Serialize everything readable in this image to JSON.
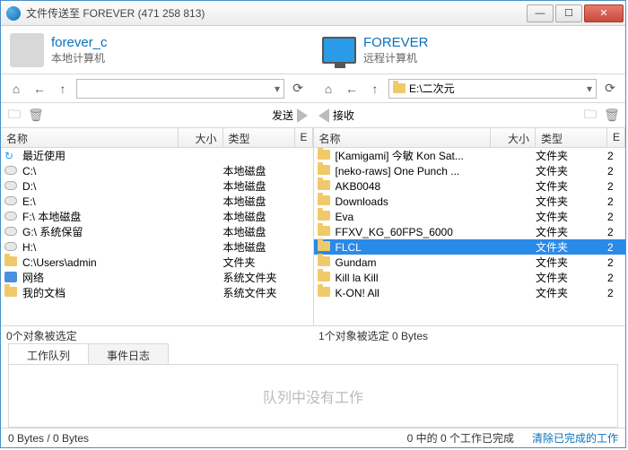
{
  "window": {
    "title": "文件传送至 FOREVER (471 258 813)"
  },
  "hosts": {
    "local": {
      "name": "forever_c",
      "sub": "本地计算机"
    },
    "remote": {
      "name": "FOREVER",
      "sub": "远程计算机"
    }
  },
  "nav": {
    "remote_path": "E:\\二次元"
  },
  "actions": {
    "send": "发送",
    "recv": "接收"
  },
  "columns": {
    "name": "名称",
    "size": "大小",
    "type": "类型",
    "e": "E"
  },
  "local_items": [
    {
      "icon": "recent",
      "name": "最近使用",
      "type": ""
    },
    {
      "icon": "drive",
      "name": "C:\\",
      "type": "本地磁盘"
    },
    {
      "icon": "drive",
      "name": "D:\\",
      "type": "本地磁盘"
    },
    {
      "icon": "drive",
      "name": "E:\\",
      "type": "本地磁盘"
    },
    {
      "icon": "drive",
      "name": "F:\\ 本地磁盘",
      "type": "本地磁盘"
    },
    {
      "icon": "drive",
      "name": "G:\\ 系统保留",
      "type": "本地磁盘"
    },
    {
      "icon": "drive",
      "name": "H:\\",
      "type": "本地磁盘"
    },
    {
      "icon": "folder",
      "name": "C:\\Users\\admin",
      "type": "文件夹"
    },
    {
      "icon": "net",
      "name": "网络",
      "type": "系统文件夹"
    },
    {
      "icon": "folder",
      "name": "我的文档",
      "type": "系统文件夹"
    }
  ],
  "remote_items": [
    {
      "name": "[Kamigami] 今敏 Kon Sat...",
      "type": "文件夹",
      "e": "2"
    },
    {
      "name": "[neko-raws] One Punch ...",
      "type": "文件夹",
      "e": "2"
    },
    {
      "name": "AKB0048",
      "type": "文件夹",
      "e": "2"
    },
    {
      "name": "Downloads",
      "type": "文件夹",
      "e": "2"
    },
    {
      "name": "Eva",
      "type": "文件夹",
      "e": "2"
    },
    {
      "name": "FFXV_KG_60FPS_6000",
      "type": "文件夹",
      "e": "2"
    },
    {
      "name": "FLCL",
      "type": "文件夹",
      "e": "2",
      "selected": true
    },
    {
      "name": "Gundam",
      "type": "文件夹",
      "e": "2"
    },
    {
      "name": "Kill la Kill",
      "type": "文件夹",
      "e": "2"
    },
    {
      "name": "K-ON! All",
      "type": "文件夹",
      "e": "2"
    }
  ],
  "status": {
    "left": "0个对象被选定",
    "right": "1个对象被选定  0 Bytes"
  },
  "tabs": {
    "queue": "工作队列",
    "log": "事件日志"
  },
  "queue_empty": "队列中没有工作",
  "bottom": {
    "left": "0 Bytes / 0 Bytes",
    "center": "0 中的 0 个工作已完成",
    "right": "清除已完成的工作"
  }
}
